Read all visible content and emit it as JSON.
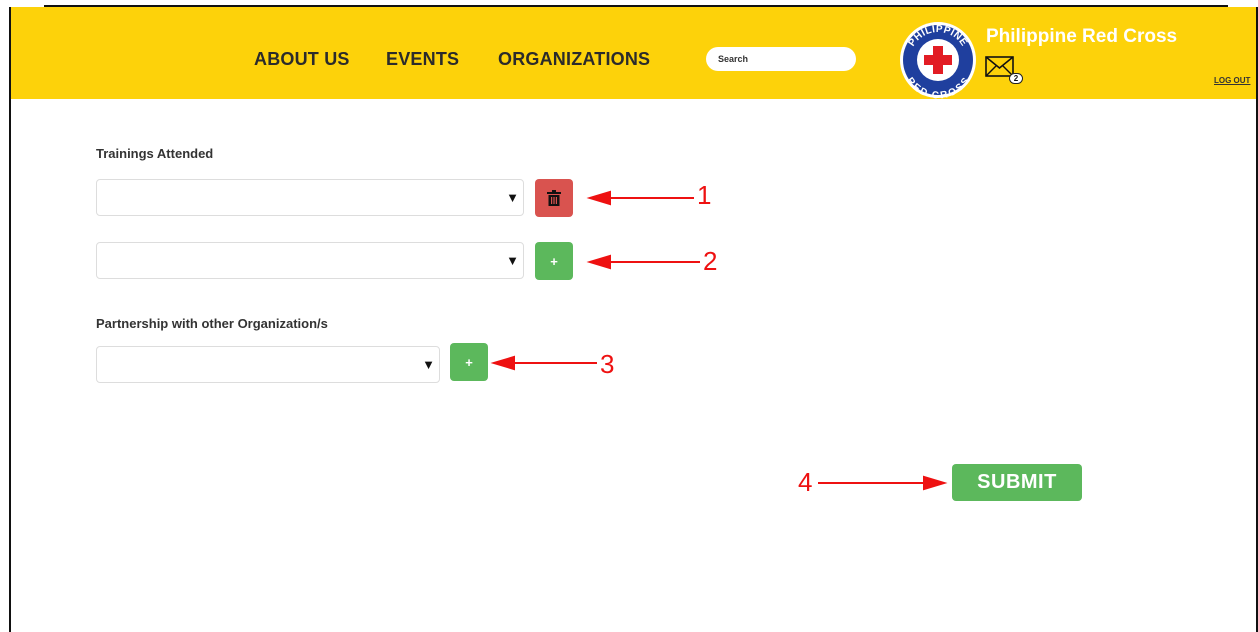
{
  "header": {
    "nav": {
      "about": "ABOUT US",
      "events": "EVENTS",
      "organizations": "ORGANIZATIONS"
    },
    "search": {
      "placeholder": "Search",
      "value": ""
    },
    "brand": "Philippine Red Cross",
    "logo": {
      "ring_top": "PHILIPPINE",
      "ring_bottom": "RED CROSS",
      "icon": "red-cross-logo"
    },
    "mail": {
      "icon": "envelope-icon",
      "badge_count": "2"
    },
    "logout": "LOG OUT",
    "colors": {
      "background": "#fdd20a",
      "brand_text": "#ffffff"
    }
  },
  "form": {
    "trainings": {
      "label": "Trainings Attended",
      "rows": [
        {
          "value": "",
          "action": "delete",
          "action_icon": "trash-icon"
        },
        {
          "value": "",
          "action": "add",
          "action_label": "+"
        }
      ]
    },
    "partnerships": {
      "label": "Partnership with other Organization/s",
      "rows": [
        {
          "value": "",
          "action": "add",
          "action_label": "+"
        }
      ]
    },
    "submit_label": "SUBMIT",
    "select_arrow": "▼",
    "colors": {
      "delete": "#d9534f",
      "add": "#5cb85c",
      "submit": "#5cb85c"
    }
  },
  "annotations": {
    "color": "#ee1111",
    "markers": [
      "1",
      "2",
      "3",
      "4"
    ]
  }
}
